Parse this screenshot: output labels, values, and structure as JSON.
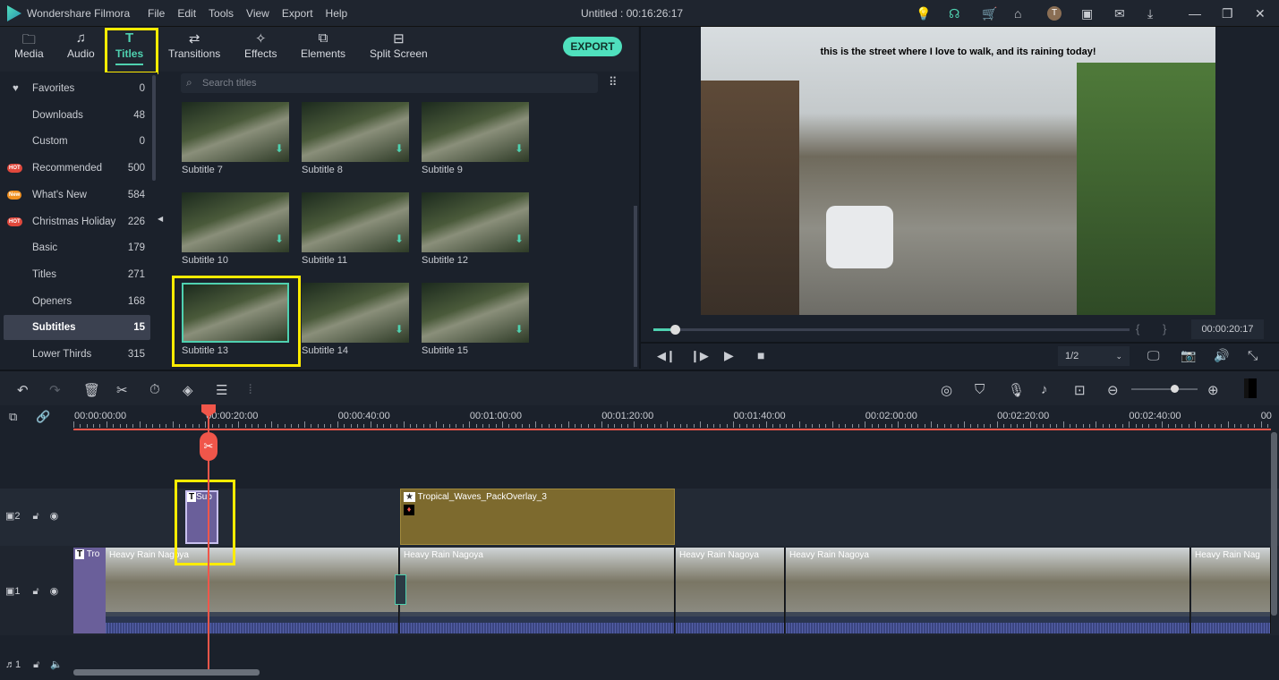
{
  "app": {
    "name": "Wondershare Filmora",
    "title": "Untitled : 00:16:26:17",
    "menu": [
      "File",
      "Edit",
      "Tools",
      "View",
      "Export",
      "Help"
    ],
    "icons": [
      "bulb-icon",
      "headset-icon",
      "cart-icon",
      "gift-icon",
      "avatar-icon",
      "save-icon",
      "mail-icon",
      "download-icon",
      "minimize-icon",
      "maximize-icon",
      "close-icon"
    ],
    "avatar_letter": "T"
  },
  "tabs": [
    {
      "label": "Media",
      "icon": "folder-icon"
    },
    {
      "label": "Audio",
      "icon": "music-icon"
    },
    {
      "label": "Titles",
      "icon": "title-icon",
      "active": true
    },
    {
      "label": "Transitions",
      "icon": "transitions-icon"
    },
    {
      "label": "Effects",
      "icon": "effects-icon"
    },
    {
      "label": "Elements",
      "icon": "elements-icon"
    },
    {
      "label": "Split Screen",
      "icon": "split-screen-icon"
    }
  ],
  "export_label": "EXPORT",
  "sidebar": [
    {
      "label": "Favorites",
      "count": "0"
    },
    {
      "label": "Downloads",
      "count": "48"
    },
    {
      "label": "Custom",
      "count": "0"
    },
    {
      "label": "Recommended",
      "count": "500",
      "badge": "HOT"
    },
    {
      "label": "What's New",
      "count": "584",
      "badge": "New"
    },
    {
      "label": "Christmas Holiday",
      "count": "226",
      "badge": "HOT"
    },
    {
      "label": "Basic",
      "count": "179"
    },
    {
      "label": "Titles",
      "count": "271"
    },
    {
      "label": "Openers",
      "count": "168"
    },
    {
      "label": "Subtitles",
      "count": "15",
      "selected": true
    },
    {
      "label": "Lower Thirds",
      "count": "315"
    }
  ],
  "search_placeholder": "Search titles",
  "thumbs": [
    "Subtitle 7",
    "Subtitle 8",
    "Subtitle 9",
    "Subtitle 10",
    "Subtitle 11",
    "Subtitle 12",
    "Subtitle 13",
    "Subtitle 14",
    "Subtitle 15"
  ],
  "preview": {
    "caption": "this is the street where I love to walk, and its raining today!",
    "time": "00:00:20:17",
    "progress": 0.02,
    "quality": "1/2",
    "bracket_in": "{",
    "bracket_out": "}"
  },
  "timeline": {
    "ruler": [
      "00:00:00:00",
      "00:00:20:00",
      "00:00:40:00",
      "00:01:00:00",
      "00:01:20:00",
      "00:01:40:00",
      "00:02:00:00",
      "00:02:20:00",
      "00:02:40:00",
      "00"
    ],
    "zoom_level": 0.65,
    "tracks": {
      "v2": "2",
      "v1": "1",
      "a1": "1"
    },
    "clips": {
      "subtitle": "Sub",
      "overlay": "Tropical_Waves_PackOverlay_3",
      "title_clip": "Tro",
      "videos": [
        "Heavy Rain Nagoya",
        "Heavy Rain Nagoya",
        "Heavy Rain Nagoya",
        "Heavy Rain Nagoya",
        "Heavy Rain Nag"
      ]
    }
  },
  "colors": {
    "accent": "#4fd1b0",
    "playhead": "#f0564a",
    "highlight": "#ffec00",
    "overlay": "#7d6a2e",
    "title_clip": "#6a5f9a"
  }
}
